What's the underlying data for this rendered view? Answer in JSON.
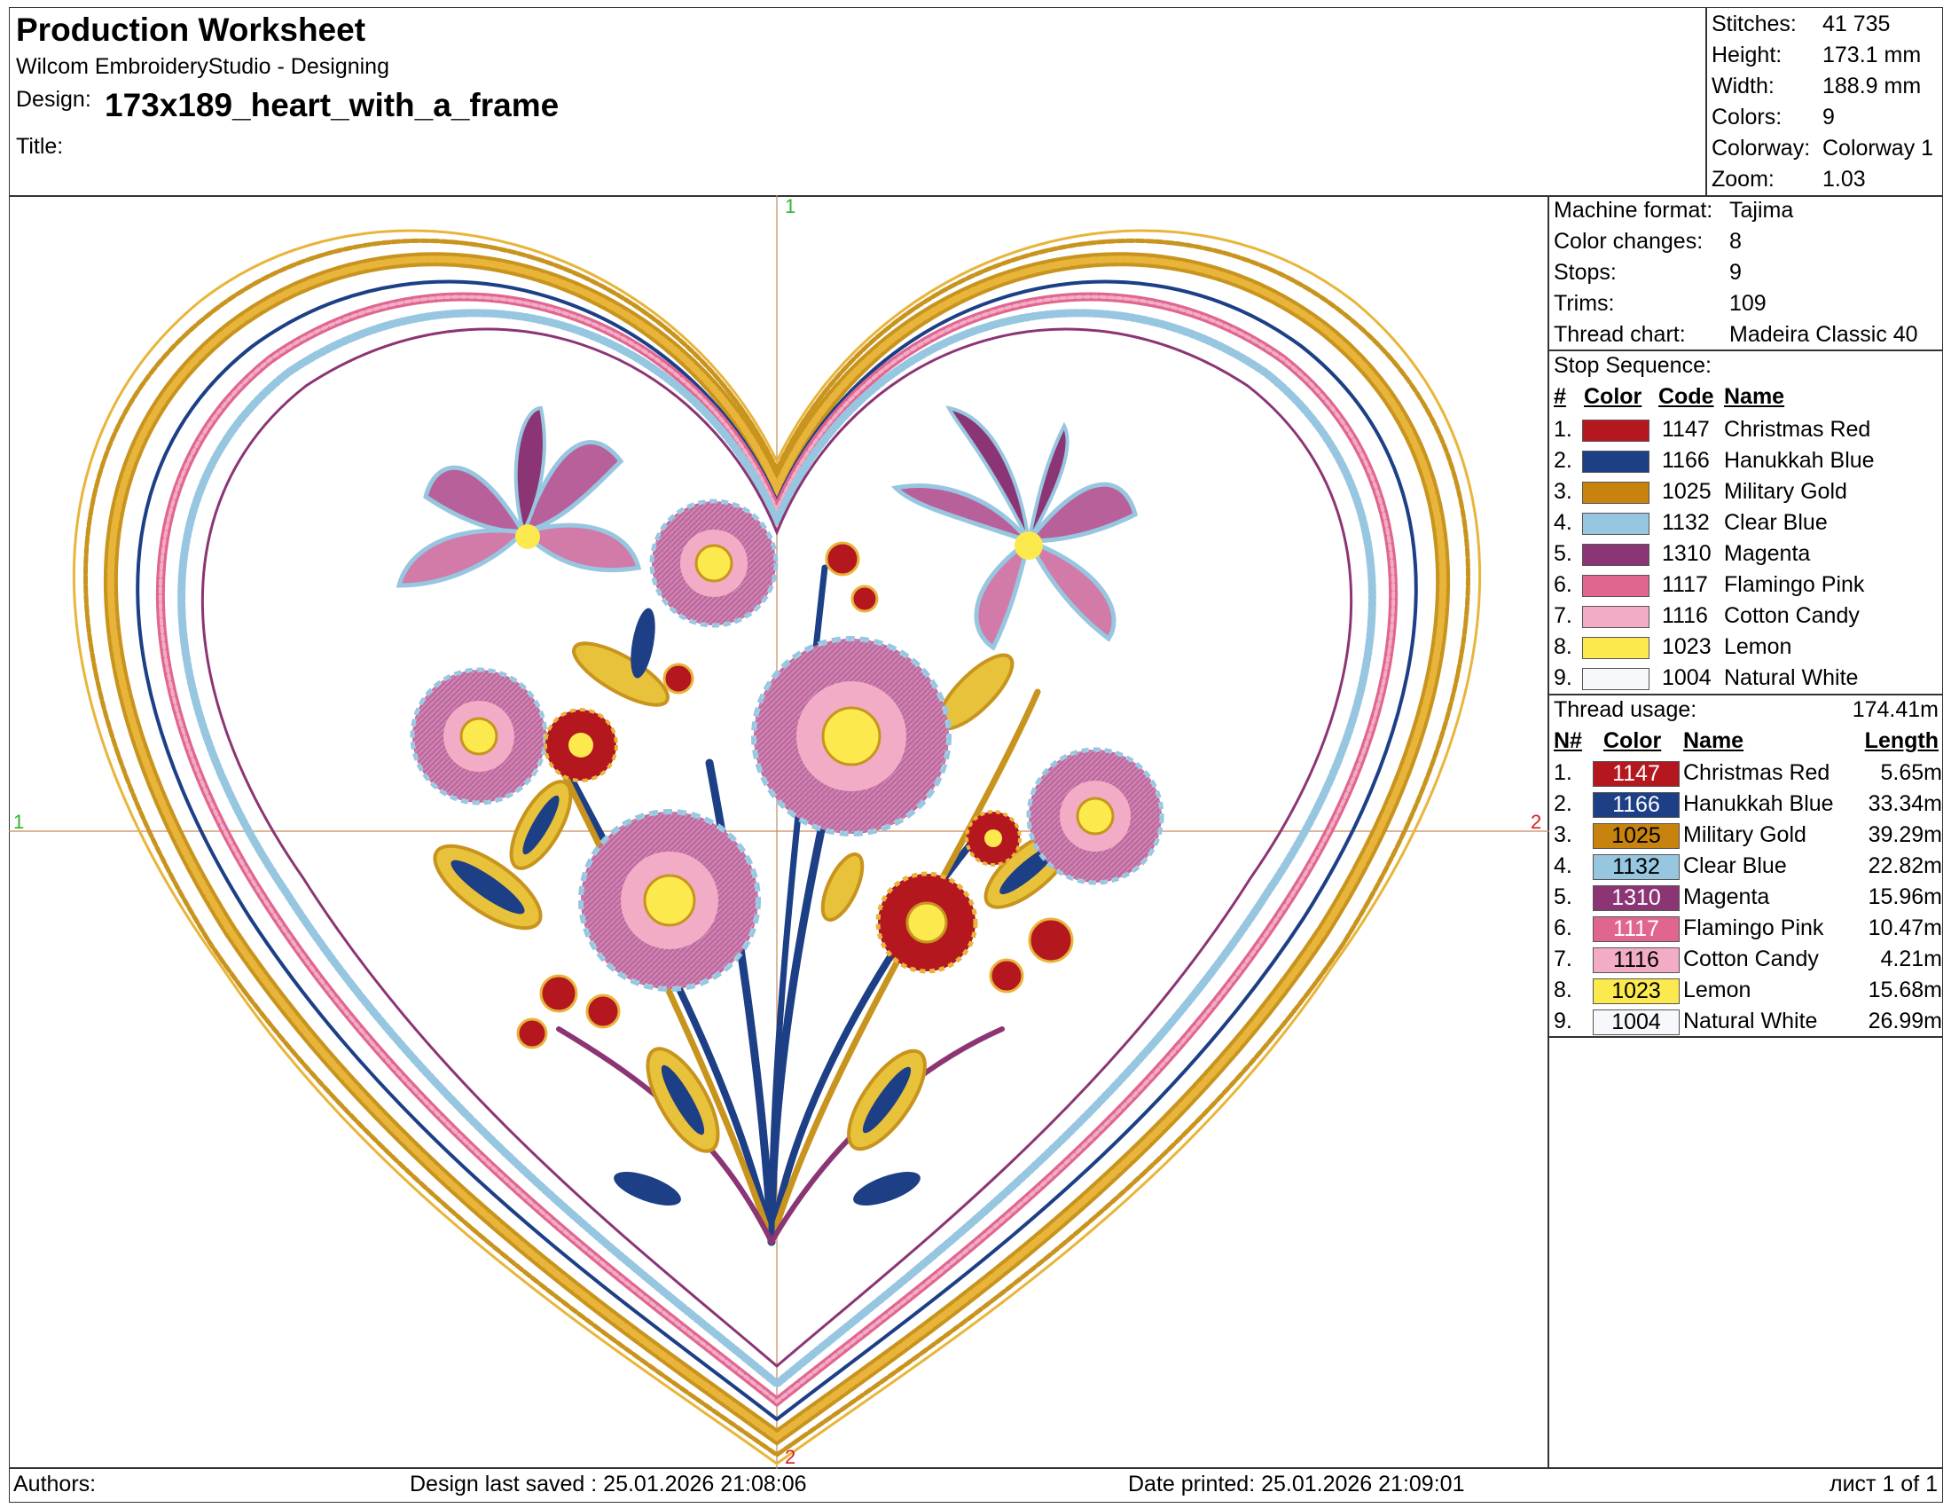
{
  "header": {
    "title": "Production Worksheet",
    "app": "Wilcom EmbroideryStudio - Designing",
    "design_label": "Design:",
    "design_name": "173x189_heart_with_a_frame",
    "title_label": "Title:"
  },
  "stats": [
    {
      "label": "Stitches:",
      "value": "41 735"
    },
    {
      "label": "Height:",
      "value": "173.1 mm"
    },
    {
      "label": "Width:",
      "value": "188.9 mm"
    },
    {
      "label": "Colors:",
      "value": "9"
    },
    {
      "label": "Colorway:",
      "value": "Colorway 1"
    },
    {
      "label": "Zoom:",
      "value": "1.03"
    }
  ],
  "machine": [
    {
      "label": "Machine format:",
      "value": "Tajima"
    },
    {
      "label": "Color changes:",
      "value": "8"
    },
    {
      "label": "Stops:",
      "value": "9"
    },
    {
      "label": "Trims:",
      "value": "109"
    },
    {
      "label": "Thread chart:",
      "value": "Madeira Classic 40"
    }
  ],
  "stop_sequence": {
    "title": "Stop Sequence:",
    "headers": {
      "num": "#",
      "color": "Color",
      "code": "Code",
      "name": "Name"
    },
    "rows": [
      {
        "n": "1.",
        "color": "#b5171f",
        "code": "1147",
        "name": "Christmas Red"
      },
      {
        "n": "2.",
        "color": "#1c3f86",
        "code": "1166",
        "name": "Hanukkah Blue"
      },
      {
        "n": "3.",
        "color": "#c8820e",
        "code": "1025",
        "name": "Military Gold"
      },
      {
        "n": "4.",
        "color": "#97c6e0",
        "code": "1132",
        "name": "Clear Blue"
      },
      {
        "n": "5.",
        "color": "#8b3574",
        "code": "1310",
        "name": "Magenta"
      },
      {
        "n": "6.",
        "color": "#e06690",
        "code": "1117",
        "name": "Flamingo Pink"
      },
      {
        "n": "7.",
        "color": "#f2acc6",
        "code": "1116",
        "name": "Cotton Candy"
      },
      {
        "n": "8.",
        "color": "#fbe94e",
        "code": "1023",
        "name": "Lemon"
      },
      {
        "n": "9.",
        "color": "#f6f8fb",
        "code": "1004",
        "name": "Natural White"
      }
    ]
  },
  "thread_usage": {
    "title": "Thread usage:",
    "total": "174.41m",
    "headers": {
      "num": "N#",
      "color": "Color",
      "name": "Name",
      "length": "Length"
    },
    "rows": [
      {
        "n": "1.",
        "color": "#b5171f",
        "text": "#ffffff",
        "code": "1147",
        "name": "Christmas Red",
        "length": "5.65m"
      },
      {
        "n": "2.",
        "color": "#1c3f86",
        "text": "#ffffff",
        "code": "1166",
        "name": "Hanukkah Blue",
        "length": "33.34m"
      },
      {
        "n": "3.",
        "color": "#c8820e",
        "text": "#000000",
        "code": "1025",
        "name": "Military Gold",
        "length": "39.29m"
      },
      {
        "n": "4.",
        "color": "#97c6e0",
        "text": "#000000",
        "code": "1132",
        "name": "Clear Blue",
        "length": "22.82m"
      },
      {
        "n": "5.",
        "color": "#8b3574",
        "text": "#ffffff",
        "code": "1310",
        "name": "Magenta",
        "length": "15.96m"
      },
      {
        "n": "6.",
        "color": "#e06690",
        "text": "#ffffff",
        "code": "1117",
        "name": "Flamingo Pink",
        "length": "10.47m"
      },
      {
        "n": "7.",
        "color": "#f2acc6",
        "text": "#000000",
        "code": "1116",
        "name": "Cotton Candy",
        "length": "4.21m"
      },
      {
        "n": "8.",
        "color": "#fbe94e",
        "text": "#000000",
        "code": "1023",
        "name": "Lemon",
        "length": "15.68m"
      },
      {
        "n": "9.",
        "color": "#f6f8fb",
        "text": "#000000",
        "code": "1004",
        "name": "Natural White",
        "length": "26.99m"
      }
    ]
  },
  "markers": {
    "top": "1",
    "left": "1",
    "right": "2",
    "bottom": "2"
  },
  "footer": {
    "authors": "Authors:",
    "saved": "Design last saved : 25.01.2026 21:08:06",
    "printed": "Date printed: 25.01.2026 21:09:01",
    "page": "лист 1 of 1"
  }
}
